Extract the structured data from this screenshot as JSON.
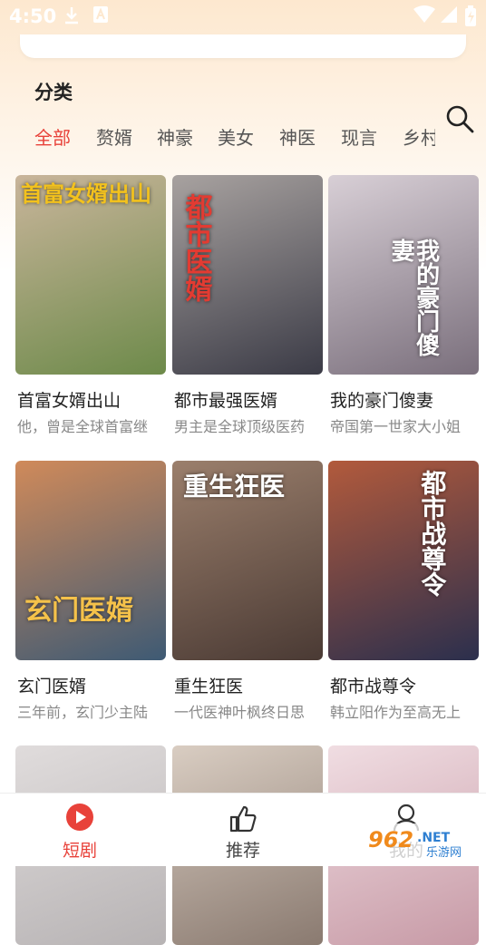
{
  "status_bar": {
    "time": "4:50",
    "icons": [
      "download-icon",
      "app-a-icon",
      "wifi-icon",
      "signal-icon",
      "battery-icon"
    ]
  },
  "section": {
    "title": "分类"
  },
  "tabs": [
    {
      "label": "全部",
      "active": true
    },
    {
      "label": "赘婿",
      "active": false
    },
    {
      "label": "神豪",
      "active": false
    },
    {
      "label": "美女",
      "active": false
    },
    {
      "label": "神医",
      "active": false
    },
    {
      "label": "现言",
      "active": false
    },
    {
      "label": "乡村",
      "active": false
    }
  ],
  "search": {
    "icon": "search-icon"
  },
  "dramas": [
    {
      "title": "首富女婿出山",
      "desc": "他，曾是全球首富继",
      "poster_text": "首富女婿出山",
      "colors": [
        "#6d8a4a",
        "#c9b59b"
      ]
    },
    {
      "title": "都市最强医婿",
      "desc": "男主是全球顶级医药",
      "poster_text": "都市医婿",
      "colors": [
        "#3b3b46",
        "#a8a2a0"
      ]
    },
    {
      "title": "我的豪门傻妻",
      "desc": "帝国第一世家大小姐",
      "poster_text": "我的豪门傻妻",
      "colors": [
        "#7a6f7c",
        "#d8cfd6"
      ]
    },
    {
      "title": "玄门医婿",
      "desc": "三年前，玄门少主陆",
      "poster_text": "玄门医婿",
      "colors": [
        "#3e5a74",
        "#d08a5a"
      ]
    },
    {
      "title": "重生狂医",
      "desc": "一代医神叶枫终日思",
      "poster_text": "重生狂医",
      "colors": [
        "#4a3a34",
        "#9b7f6c"
      ]
    },
    {
      "title": "都市战尊令",
      "desc": "韩立阳作为至高无上",
      "poster_text": "都市战尊令",
      "colors": [
        "#2b2f4d",
        "#b25a3c"
      ]
    },
    {
      "title": "",
      "desc": "",
      "poster_text": "",
      "colors": [
        "#b7b3b4",
        "#e0dcdc"
      ]
    },
    {
      "title": "",
      "desc": "",
      "poster_text": "",
      "colors": [
        "#8a7a70",
        "#d9cdc2"
      ]
    },
    {
      "title": "",
      "desc": "",
      "poster_text": "",
      "colors": [
        "#c79aa6",
        "#f0dde2"
      ]
    }
  ],
  "bottom_nav": [
    {
      "label": "短剧",
      "icon": "play-circle-icon",
      "active": true
    },
    {
      "label": "推荐",
      "icon": "thumbs-up-icon",
      "active": false
    },
    {
      "label": "我的",
      "icon": "person-icon",
      "active": false
    }
  ],
  "watermark": {
    "text": "962.NET",
    "subtext": "乐游网"
  },
  "colors": {
    "accent": "#e8423a",
    "text": "#222222",
    "muted": "#888888"
  }
}
